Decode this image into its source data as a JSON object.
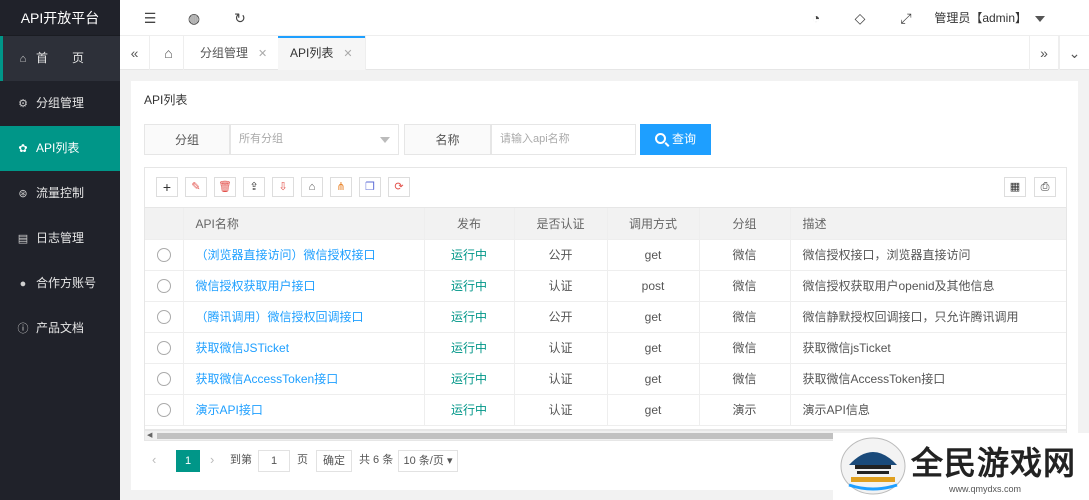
{
  "sidebar": {
    "brand": "API开放平台",
    "items": [
      {
        "label": "首　　页",
        "icon": "home-icon"
      },
      {
        "label": "分组管理",
        "icon": "settings-icon"
      },
      {
        "label": "API列表",
        "icon": "api-icon"
      },
      {
        "label": "流量控制",
        "icon": "flow-icon"
      },
      {
        "label": "日志管理",
        "icon": "log-icon"
      },
      {
        "label": "合作方账号",
        "icon": "user-icon"
      },
      {
        "label": "产品文档",
        "icon": "info-icon"
      }
    ]
  },
  "header": {
    "user": "管理员【admin】",
    "icons": [
      "menu-toggle-icon",
      "globe-icon",
      "refresh-icon",
      "dashboard-icon",
      "tag-icon",
      "fullscreen-icon"
    ]
  },
  "tabs": {
    "items": [
      {
        "label": "分组管理"
      },
      {
        "label": "API列表"
      }
    ]
  },
  "main": {
    "title": "API列表",
    "filters": {
      "group_label": "分组",
      "group_value": "所有分组",
      "name_label": "名称",
      "name_placeholder": "请输入api名称",
      "query_label": "查询"
    },
    "toolbar": {
      "left": [
        "add-icon",
        "edit-icon",
        "delete-icon",
        "import-icon",
        "export-icon",
        "publish-icon",
        "structure-icon",
        "copy-icon",
        "sync-icon"
      ],
      "right": [
        "columns-icon",
        "print-icon"
      ]
    },
    "table": {
      "headers": [
        "API名称",
        "发布",
        "是否认证",
        "调用方式",
        "分组",
        "描述"
      ],
      "rows": [
        {
          "name": "（浏览器直接访问）微信授权接口",
          "status": "运行中",
          "auth": "公开",
          "method": "get",
          "group": "微信",
          "desc": "微信授权接口，浏览器直接访问"
        },
        {
          "name": "微信授权获取用户接口",
          "status": "运行中",
          "auth": "认证",
          "method": "post",
          "group": "微信",
          "desc": "微信授权获取用户openid及其他信息"
        },
        {
          "name": "（腾讯调用）微信授权回调接口",
          "status": "运行中",
          "auth": "公开",
          "method": "get",
          "group": "微信",
          "desc": "微信静默授权回调接口，只允许腾讯调用"
        },
        {
          "name": "获取微信JSTicket",
          "status": "运行中",
          "auth": "认证",
          "method": "get",
          "group": "微信",
          "desc": "获取微信jsTicket"
        },
        {
          "name": "获取微信AccessToken接口",
          "status": "运行中",
          "auth": "认证",
          "method": "get",
          "group": "微信",
          "desc": "获取微信AccessToken接口"
        },
        {
          "name": "演示API接口",
          "status": "运行中",
          "auth": "认证",
          "method": "get",
          "group": "演示",
          "desc": "演示API信息"
        }
      ]
    },
    "pagination": {
      "prev": "‹",
      "current": "1",
      "next": "›",
      "goto_label": "到第",
      "goto_value": "1",
      "page_unit": "页",
      "confirm": "确定",
      "total": "共 6 条",
      "page_size": "10 条/页"
    }
  },
  "watermark": {
    "text": "全民游戏网",
    "url": "www.qmydxs.com"
  }
}
